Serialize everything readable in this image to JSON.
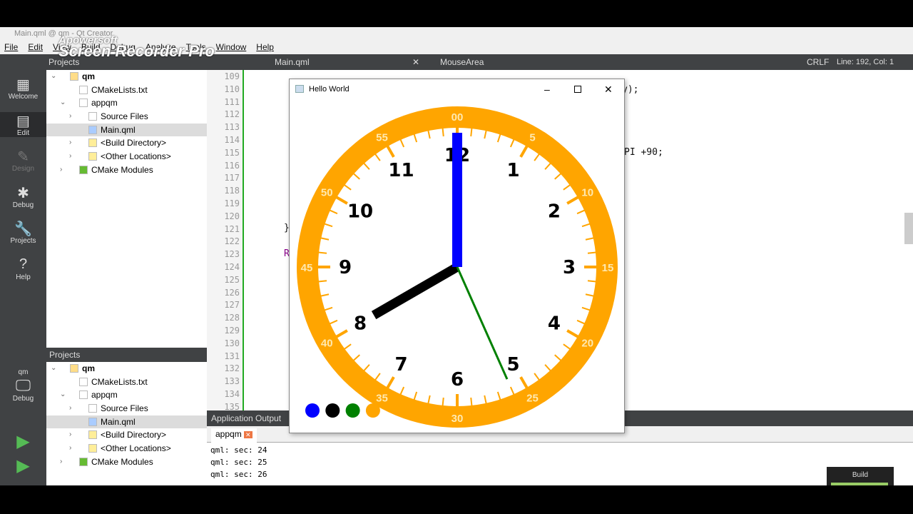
{
  "window_title": "Main.qml @ qm - Qt Creator",
  "watermark": {
    "line1": "Apowersoft",
    "line2": "Screen Recorder Pro"
  },
  "menu": [
    "File",
    "Edit",
    "View",
    "Build",
    "Debug",
    "Analyze",
    "Tools",
    "Window",
    "Help"
  ],
  "toolbar": {
    "pane": "Projects",
    "file": "Main.qml",
    "symbol": "MouseArea",
    "line_ending": "CRLF",
    "position": "Line: 192, Col: 1"
  },
  "modes": [
    {
      "label": "Welcome",
      "icon": "grid-icon"
    },
    {
      "label": "Edit",
      "icon": "edit-icon"
    },
    {
      "label": "Design",
      "icon": "pen-icon"
    },
    {
      "label": "Debug",
      "icon": "bug-icon"
    },
    {
      "label": "Projects",
      "icon": "wrench-icon"
    },
    {
      "label": "Help",
      "icon": "help-icon"
    }
  ],
  "kit": {
    "project": "qm",
    "mode": "Debug"
  },
  "tree": [
    {
      "label": "qm",
      "level": 0,
      "chev": "v",
      "bold": true
    },
    {
      "label": "CMakeLists.txt",
      "level": 1
    },
    {
      "label": "appqm",
      "level": 1,
      "chev": "v"
    },
    {
      "label": "Source Files",
      "level": 2,
      "chev": ">"
    },
    {
      "label": "Main.qml",
      "level": 2,
      "selected": true
    },
    {
      "label": "<Build Directory>",
      "level": 2,
      "chev": ">"
    },
    {
      "label": "<Other Locations>",
      "level": 2,
      "chev": ">"
    },
    {
      "label": "CMake Modules",
      "level": 1,
      "chev": ">"
    }
  ],
  "projects_header": "Projects",
  "line_numbers": [
    "109",
    "110",
    "111",
    "112",
    "113",
    "114",
    "115",
    "116",
    "117",
    "118",
    "119",
    "120",
    "121",
    "122",
    "123",
    "124",
    "125",
    "126",
    "127",
    "128",
    "129",
    "130",
    "131",
    "132",
    "133",
    "134",
    "135"
  ],
  "code_fragments": {
    "l110": "y);",
    "l115": "PI +90;",
    "l121": "}",
    "l123": "R"
  },
  "output": {
    "title": "Application Output",
    "tab": "appqm",
    "lines": [
      "qml: sec: 24",
      "qml: sec: 25",
      "qml: sec: 26"
    ]
  },
  "build_label": "Build",
  "app": {
    "title": "Hello World",
    "clock": {
      "hour_numbers": [
        "12",
        "1",
        "2",
        "3",
        "4",
        "5",
        "6",
        "7",
        "8",
        "9",
        "10",
        "11"
      ],
      "minute_labels": [
        "00",
        "5",
        "10",
        "15",
        "20",
        "25",
        "30",
        "35",
        "40",
        "45",
        "50",
        "55"
      ],
      "time": {
        "hour": 8,
        "minute": 0,
        "second": 26
      },
      "colors": {
        "ring": "#ffa500",
        "minute_hand": "#0000ff",
        "hour_hand": "#000000",
        "second_hand": "#008000"
      }
    },
    "color_dots": [
      "#0000ff",
      "#000000",
      "#008000",
      "#ffa500"
    ]
  }
}
